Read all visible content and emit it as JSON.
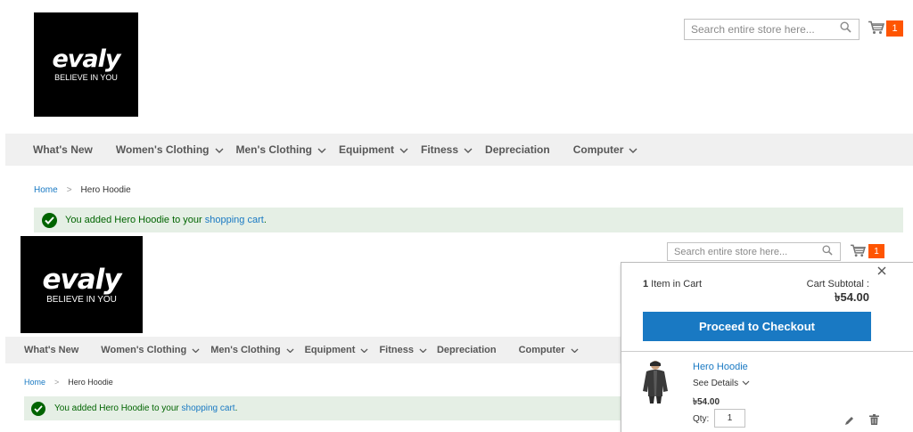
{
  "brand": {
    "wordmark": "evaly",
    "tagline": "BELIEVE IN YOU"
  },
  "search": {
    "placeholder": "Search entire store here..."
  },
  "cart": {
    "count": "1"
  },
  "nav": {
    "items": [
      {
        "label": "What's New",
        "has_dropdown": false
      },
      {
        "label": "Women's Clothing",
        "has_dropdown": true
      },
      {
        "label": "Men's Clothing",
        "has_dropdown": true
      },
      {
        "label": "Equipment",
        "has_dropdown": true
      },
      {
        "label": "Fitness",
        "has_dropdown": true
      },
      {
        "label": "Depreciation",
        "has_dropdown": false
      },
      {
        "label": "Computer",
        "has_dropdown": true
      }
    ]
  },
  "breadcrumb": {
    "home": "Home",
    "separator": ">",
    "current": "Hero Hoodie"
  },
  "message": {
    "prefix": "You added Hero Hoodie to your ",
    "link": "shopping cart",
    "suffix": "."
  },
  "minicart": {
    "count": "1",
    "count_suffix": " Item in Cart",
    "subtotal_label": "Cart Subtotal :",
    "subtotal_amount": "৳54.00",
    "checkout_label": "Proceed to Checkout",
    "item": {
      "name": "Hero Hoodie",
      "see_details": "See Details",
      "price": "৳54.00",
      "qty_label": "Qty:",
      "qty_value": "1"
    }
  },
  "colors": {
    "accent_blue": "#1979c3",
    "cart_badge": "#ff5501",
    "success_bg": "#e5efe5",
    "success_text": "#006400",
    "nav_bg": "#f0f0f0"
  }
}
